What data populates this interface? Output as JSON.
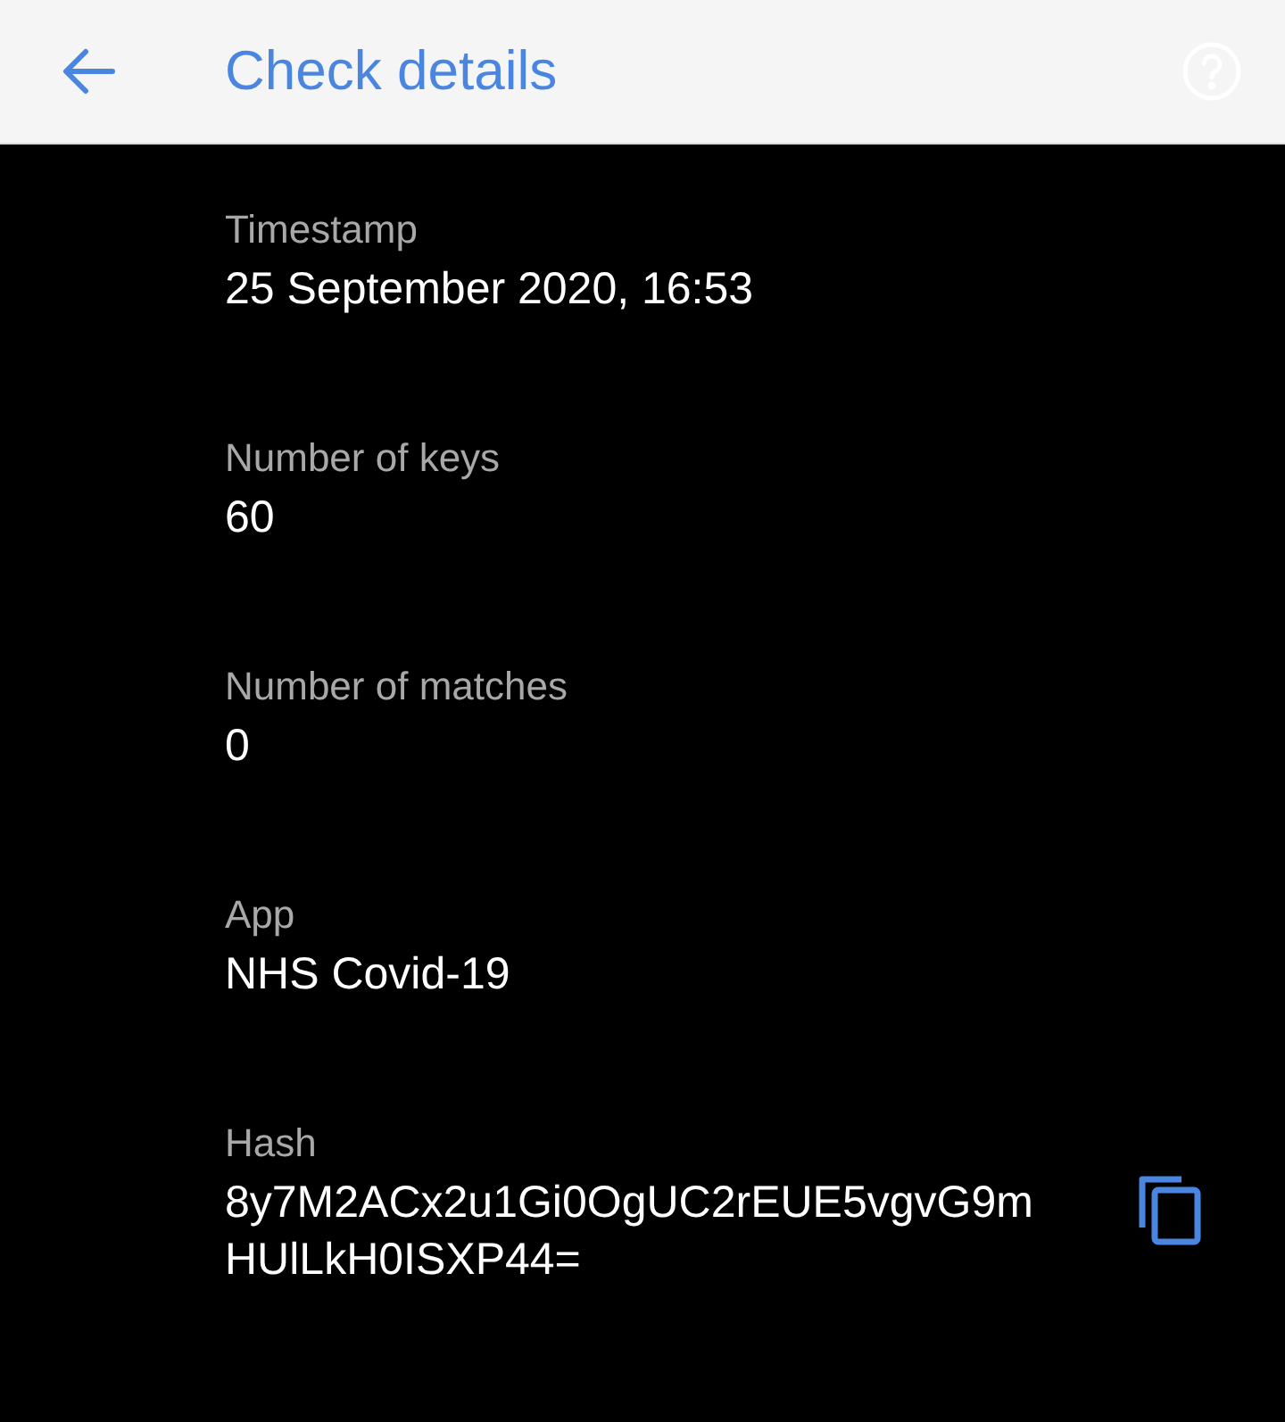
{
  "app_bar": {
    "title": "Check details"
  },
  "details": [
    {
      "kind": "plain",
      "label": "Timestamp",
      "value": "25 September 2020, 16:53"
    },
    {
      "kind": "plain",
      "label": "Number of keys",
      "value": "60"
    },
    {
      "kind": "plain",
      "label": "Number of matches",
      "value": "0"
    },
    {
      "kind": "plain",
      "label": "App",
      "value": "NHS Covid-19"
    },
    {
      "kind": "copyable",
      "label": "Hash",
      "value": "8y7M2ACx2u1Gi0OgUC2rEUE5vgvG9mHUlLkH0ISXP44="
    }
  ]
}
